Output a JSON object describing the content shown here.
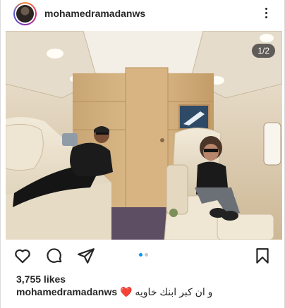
{
  "post": {
    "username": "mohamedramadanws",
    "image_counter": "1/2",
    "likes": "3,755 likes",
    "caption_user": "mohamedramadanws",
    "caption_heart": "❤️",
    "caption_text": "و ان كبر ابنك خاويه"
  },
  "icons": {
    "more": "more-options-icon",
    "like": "heart-icon",
    "comment": "comment-icon",
    "share": "paper-plane-icon",
    "save": "bookmark-icon"
  },
  "carousel": {
    "total": 2,
    "active": 1
  },
  "colors": {
    "text": "#262626",
    "active_dot": "#0095f6",
    "inactive_dot": "#c7c7c7",
    "caption_heart": "#e0245e"
  }
}
